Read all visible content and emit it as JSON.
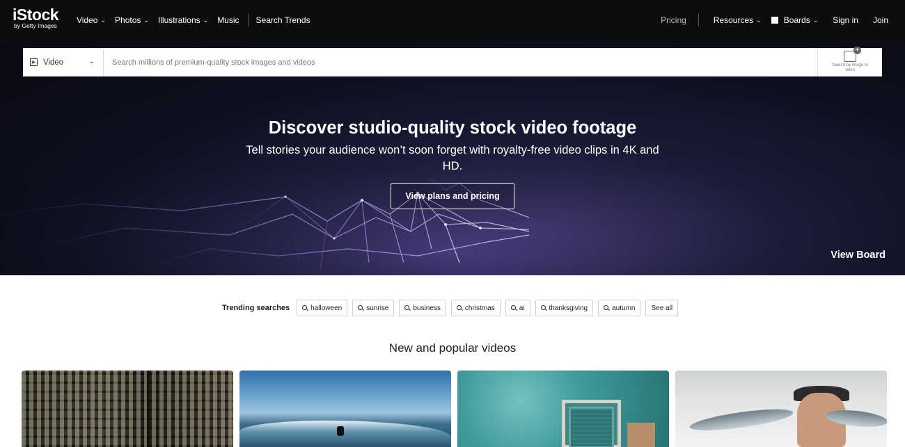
{
  "brand": {
    "name": "iStock",
    "tagline": "by Getty Images"
  },
  "nav": {
    "left": [
      {
        "label": "Video",
        "has_dropdown": true
      },
      {
        "label": "Photos",
        "has_dropdown": true
      },
      {
        "label": "Illustrations",
        "has_dropdown": true
      },
      {
        "label": "Music",
        "has_dropdown": false
      }
    ],
    "search_trends": "Search Trends",
    "pricing": "Pricing",
    "resources": "Resources",
    "boards": "Boards",
    "sign_in": "Sign in",
    "join": "Join"
  },
  "search": {
    "type_selected": "Video",
    "placeholder": "Search millions of premium-quality stock images and videos",
    "visual_search_label": "Search by image or video"
  },
  "hero": {
    "title": "Discover studio-quality stock video footage",
    "subtitle": "Tell stories your audience won’t soon forget with royalty-free video clips in 4K and HD.",
    "cta": "View plans and pricing",
    "view_board": "View Board"
  },
  "trending": {
    "label": "Trending searches",
    "chips": [
      "halloween",
      "sunrise",
      "business",
      "christmas",
      "ai",
      "thanksgiving",
      "autumn"
    ],
    "see_all": "See all"
  },
  "section_title": "New and popular videos",
  "colors": {
    "nav_bg": "#0c0d0d",
    "hero_accent": "#3a3366",
    "chip_border": "#cfcfcf"
  }
}
